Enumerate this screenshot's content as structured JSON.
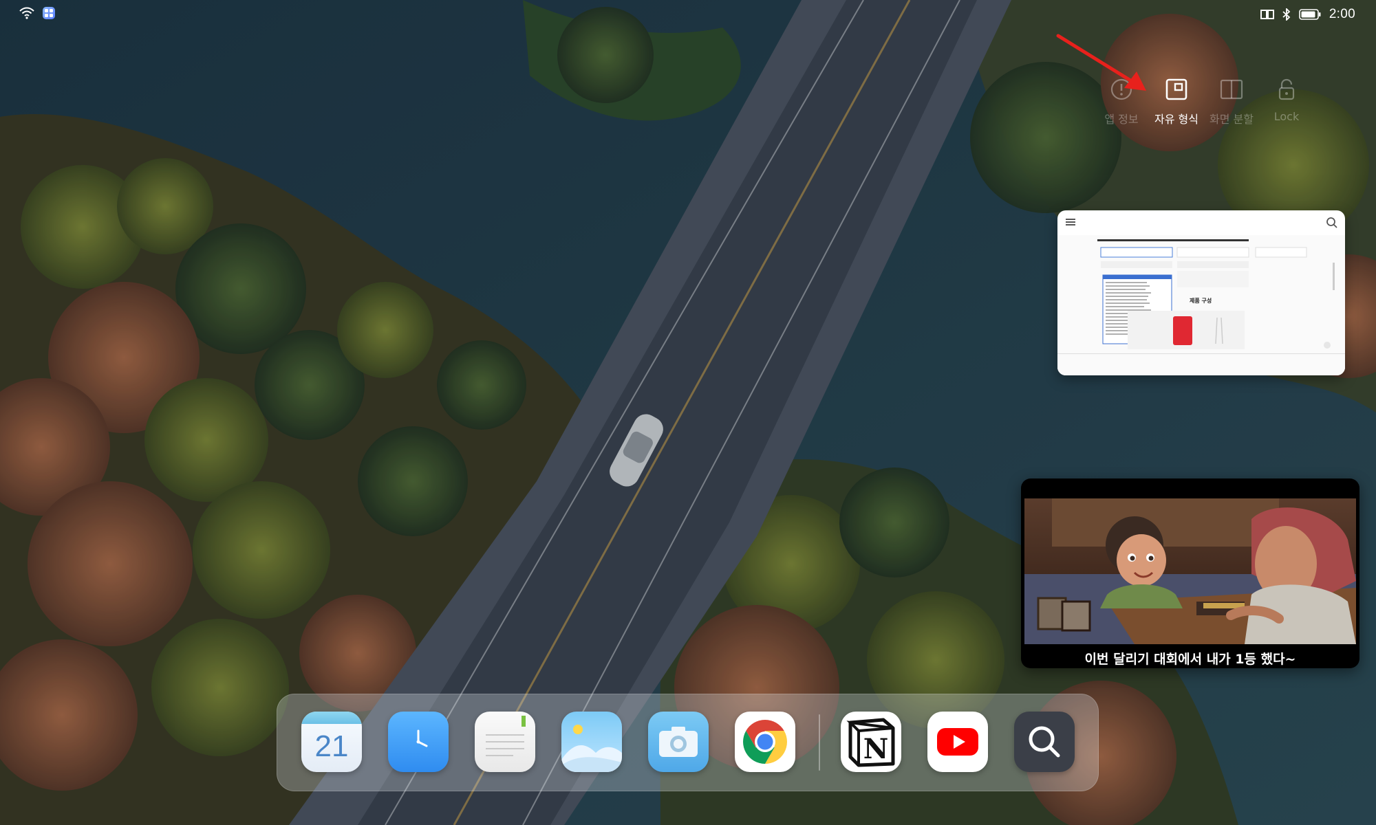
{
  "status_bar": {
    "time": "2:00",
    "left_icons": [
      "wifi-icon",
      "app-notification-icon"
    ],
    "right_icons": [
      "reader-mode-icon",
      "bluetooth-icon",
      "battery-icon"
    ]
  },
  "window_modes": {
    "items": [
      {
        "label": "앱 정보",
        "icon": "info-icon",
        "state": "dim"
      },
      {
        "label": "자유 형식",
        "icon": "floating-window-icon",
        "state": "active"
      },
      {
        "label": "화면 분할",
        "icon": "split-screen-icon",
        "state": "dim"
      },
      {
        "label": "Lock",
        "icon": "lock-icon",
        "state": "dim"
      }
    ],
    "highlight_color": "#e8211c"
  },
  "floating_browser": {
    "page_heading": "제품 구성",
    "icons": [
      "menu-icon",
      "search-icon"
    ]
  },
  "floating_video": {
    "subtitle": "이번 달리기 대회에서 내가 1등 했다~"
  },
  "dock": {
    "apps": [
      {
        "name": "calendar",
        "label": "21"
      },
      {
        "name": "clock"
      },
      {
        "name": "notes"
      },
      {
        "name": "gallery"
      },
      {
        "name": "camera"
      },
      {
        "name": "chrome"
      },
      {
        "name": "notion",
        "label": "N"
      },
      {
        "name": "youtube"
      },
      {
        "name": "search"
      }
    ]
  }
}
